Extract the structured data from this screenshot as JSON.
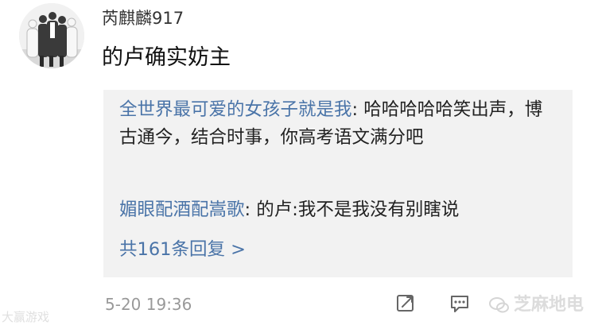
{
  "comment": {
    "username": "芮麒麟917",
    "text": "的卢确实妨主",
    "replies": [
      {
        "author": "全世界最可爱的女孩子就是我",
        "text": "哈哈哈哈哈笑出声，博古通今，结合时事，你高考语文满分吧"
      },
      {
        "author": "媚眼配酒配嵩歌",
        "text": "的卢:我不是我没有别瞎说"
      }
    ],
    "more_replies_label": "共161条回复 >",
    "timestamp": "5-20 19:36"
  },
  "actions": {
    "share_icon": "share-icon",
    "comment_icon": "comment-icon"
  },
  "watermarks": {
    "left_text": "大赢游戏",
    "right_text": "芝麻地电"
  },
  "colors": {
    "link": "#4a74a8",
    "reply_background": "#f2f2f2",
    "timestamp": "#999999"
  }
}
